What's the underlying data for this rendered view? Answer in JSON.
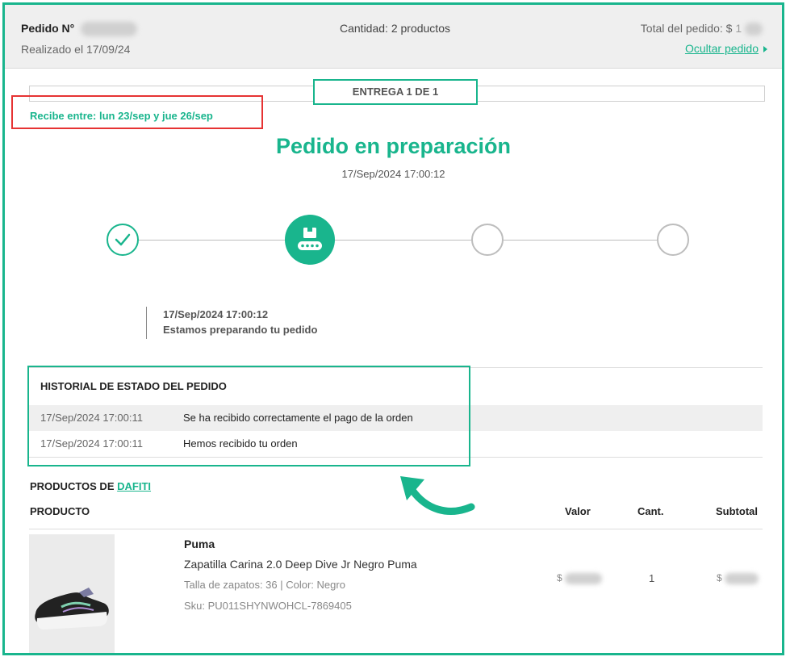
{
  "order": {
    "number_label": "Pedido N°",
    "date": "Realizado el 17/09/24",
    "quantity": "Cantidad: 2 productos",
    "total_label": "Total del pedido: $",
    "total_hint": "1",
    "hide_link": "Ocultar pedido"
  },
  "delivery": {
    "label": "ENTREGA 1 DE 1",
    "receive": "Recibe entre: lun 23/sep y jue 26/sep",
    "status": "Pedido en preparación",
    "status_date": "17/Sep/2024 17:00:12",
    "steps": [
      {
        "state": "done",
        "icon": "checkmark-icon"
      },
      {
        "state": "active",
        "icon": "conveyor-box-icon"
      },
      {
        "state": "pending",
        "icon": "empty-circle-icon"
      },
      {
        "state": "pending",
        "icon": "empty-circle-icon"
      }
    ],
    "event_date": "17/Sep/2024 17:00:12",
    "event_text": "Estamos preparando tu pedido"
  },
  "history": {
    "title": "HISTORIAL DE ESTADO DEL PEDIDO",
    "rows": [
      {
        "date": "17/Sep/2024 17:00:11",
        "message": "Se ha recibido correctamente el pago de la orden"
      },
      {
        "date": "17/Sep/2024 17:00:11",
        "message": "Hemos recibido tu orden"
      }
    ]
  },
  "products": {
    "title_prefix": "PRODUCTOS DE",
    "seller": "DAFITI",
    "headers": {
      "product": "PRODUCTO",
      "value": "Valor",
      "qty": "Cant.",
      "subtotal": "Subtotal"
    },
    "items": [
      {
        "brand": "Puma",
        "name": "Zapatilla Carina 2.0 Deep Dive Jr Negro Puma",
        "attributes": "Talla de zapatos: 36 | Color: Negro",
        "sku": "Sku: PU011SHYNWOHCL-7869405",
        "value_prefix": "$",
        "qty": "1",
        "subtotal_prefix": "$"
      }
    ]
  },
  "colors": {
    "accent": "#19b58d",
    "highlight_red": "#e63333",
    "pending": "#bdbdbd"
  }
}
